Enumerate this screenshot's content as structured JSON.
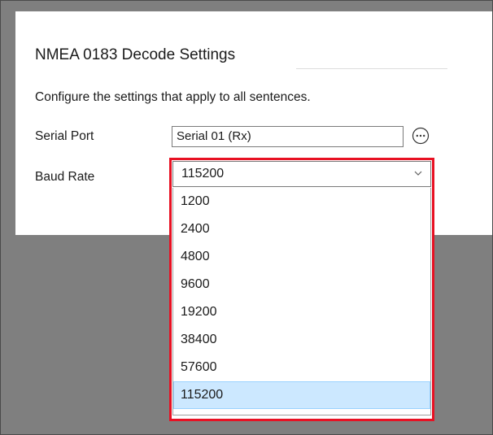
{
  "settings": {
    "title": "NMEA 0183 Decode Settings",
    "description": "Configure the settings that apply to all sentences.",
    "serial_port": {
      "label": "Serial Port",
      "value": "Serial 01 (Rx)",
      "more_icon": "ellipsis-circle-icon"
    },
    "baud_rate": {
      "label": "Baud Rate",
      "selected": "115200",
      "arrow_icon": "chevron-down-icon",
      "options": [
        "1200",
        "2400",
        "4800",
        "9600",
        "19200",
        "38400",
        "57600",
        "115200"
      ]
    }
  },
  "colors": {
    "highlight_border": "#e81123",
    "selected_option_bg": "#cce8ff",
    "overlay_bg": "#7f7f7f"
  }
}
